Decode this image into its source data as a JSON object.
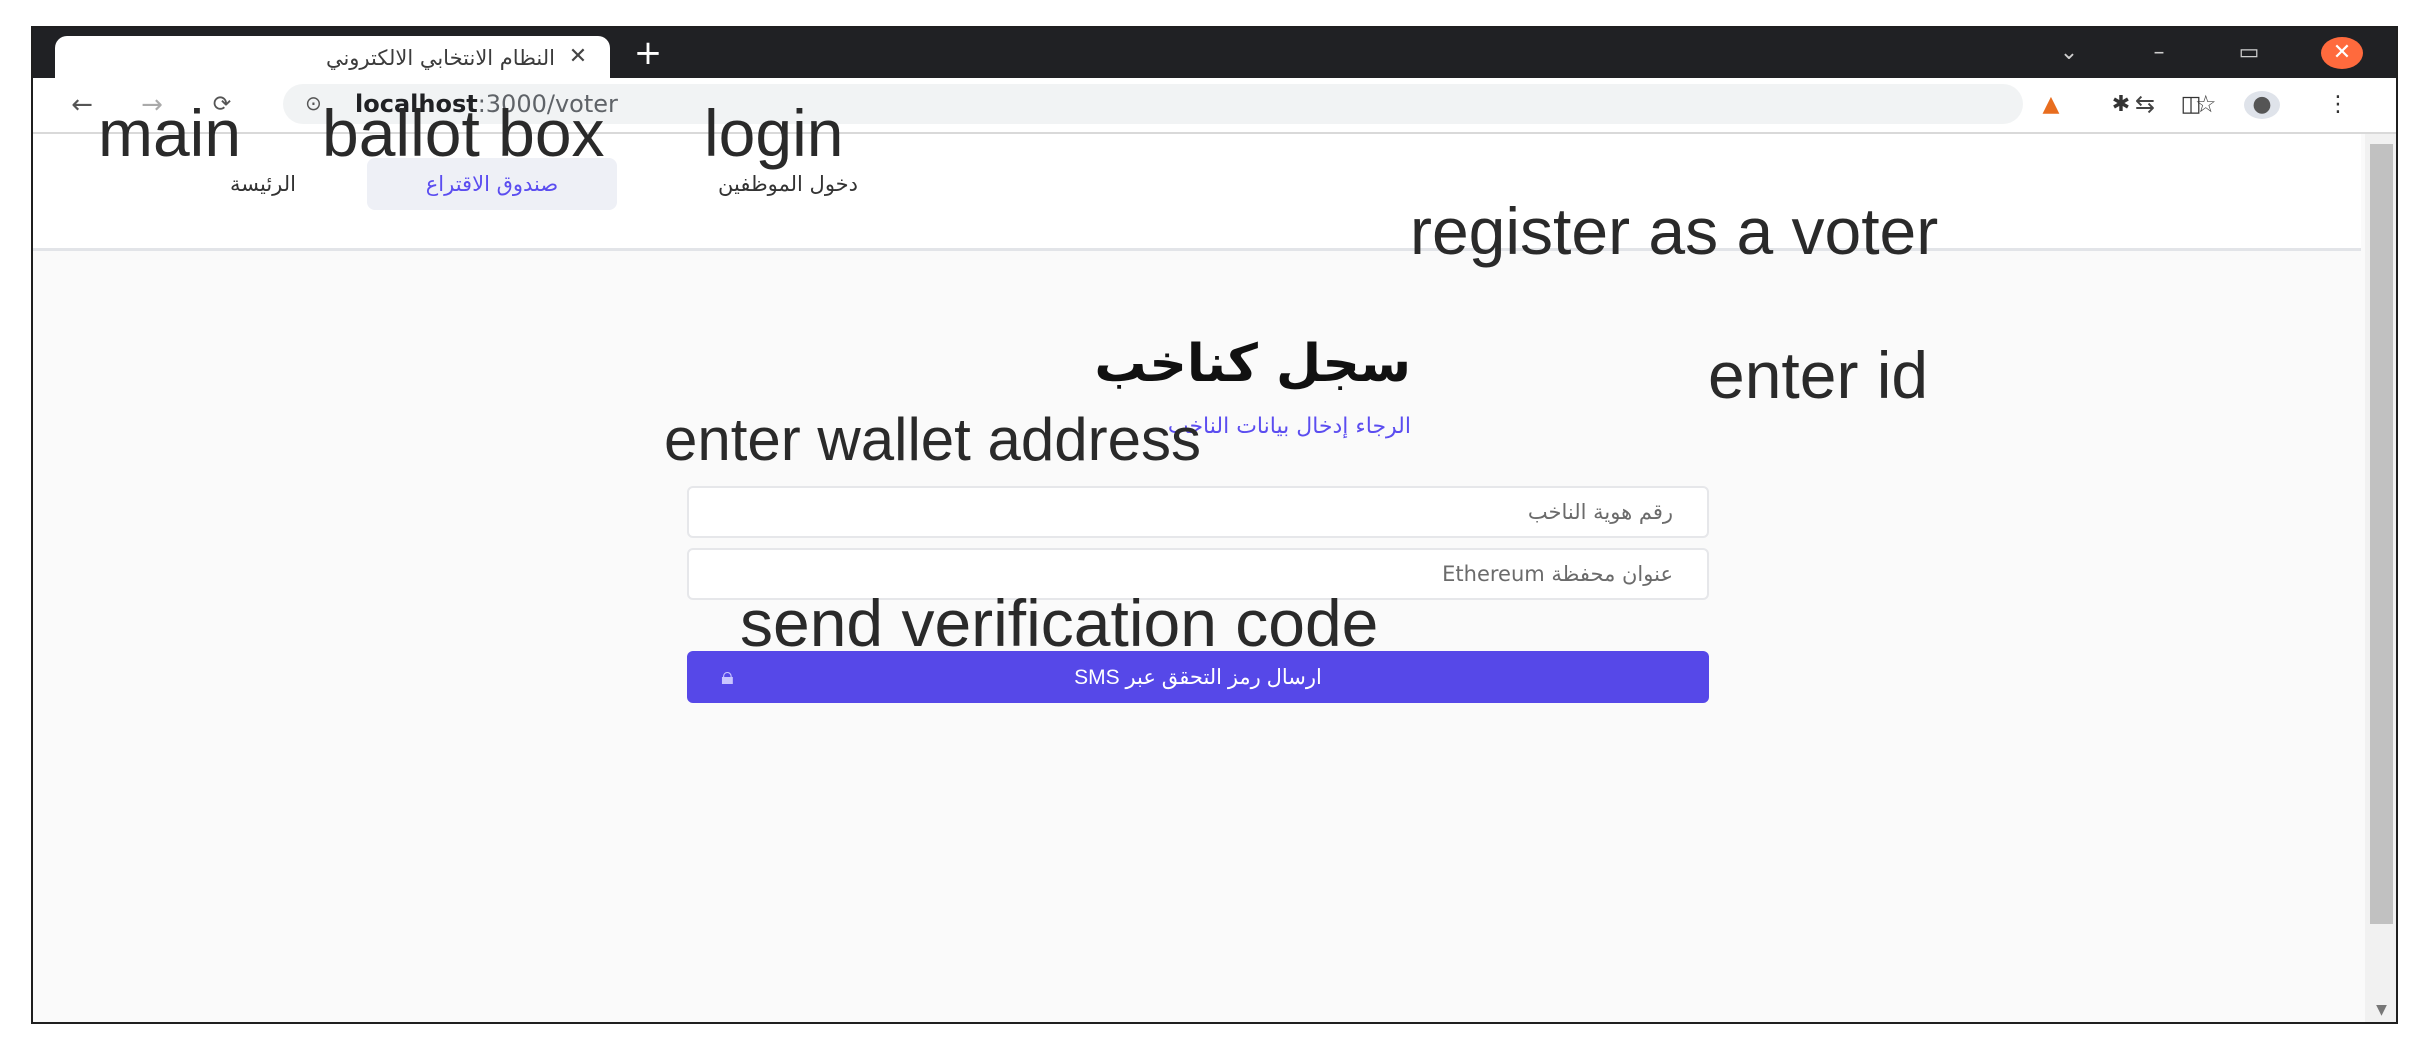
{
  "browser": {
    "tab_title": "النظام الانتخابي الالكتروني",
    "tab_close": "✕",
    "new_tab": "+",
    "url_host": "localhost",
    "url_path": ":3000/voter",
    "site_icon": "site-info-icon",
    "window_controls": {
      "down": "⌄",
      "minimize": "–",
      "maximize": "▭",
      "close": "✕"
    }
  },
  "nav": {
    "home": "الرئيسة",
    "ballot_box": "صندوق الاقتراع",
    "employee_login": "دخول الموظفين"
  },
  "annotations": {
    "main": "main",
    "ballot_box": "ballot box",
    "login": "login",
    "register": "register as a voter",
    "enter_id": "enter id",
    "enter_wallet": "enter wallet address",
    "send_code": "send verification code"
  },
  "form": {
    "heading": "سجل كناخب",
    "subheading": "الرجاء إدخال بيانات الناخب",
    "id_placeholder": "رقم هوية الناخب",
    "wallet_placeholder": "عنوان محفظة Ethereum",
    "send_button": "ارسال رمز التحقق عبر SMS"
  },
  "colors": {
    "accent": "#5648e8",
    "link": "#5b4df0",
    "tab_bar": "#202124"
  }
}
